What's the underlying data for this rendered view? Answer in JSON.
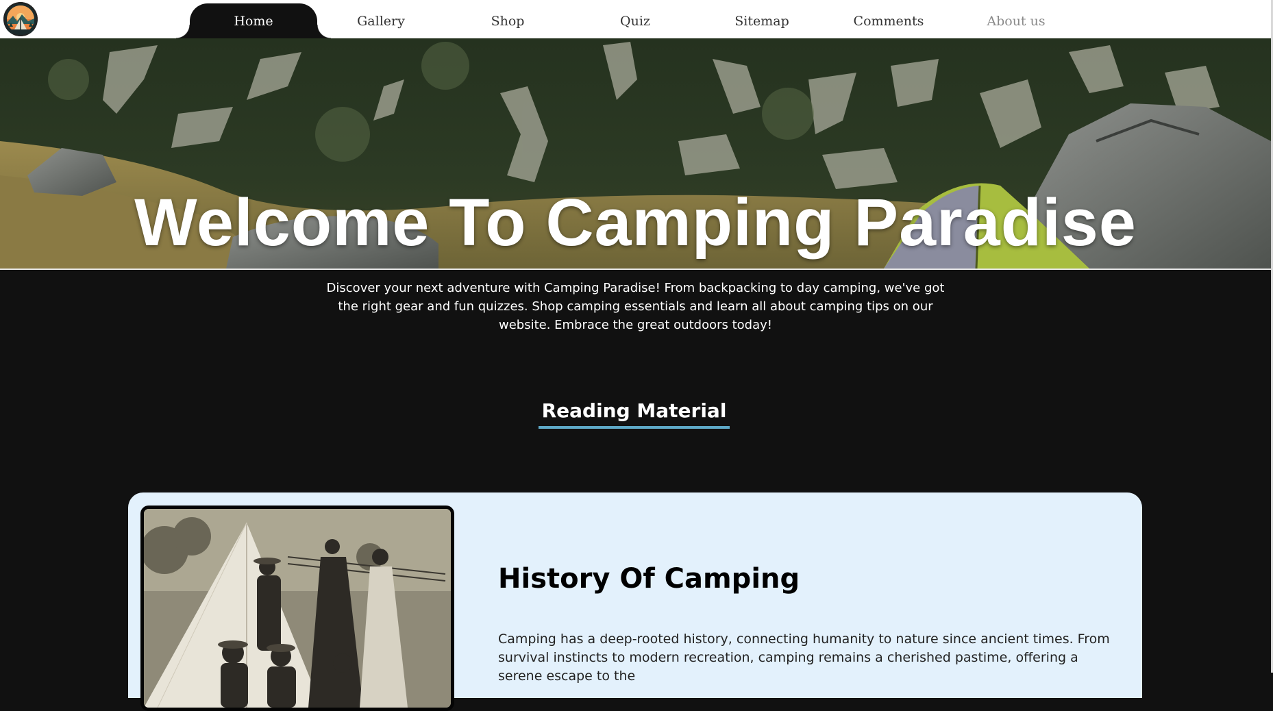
{
  "nav": {
    "items": [
      {
        "label": "Home",
        "active": true
      },
      {
        "label": "Gallery",
        "active": false
      },
      {
        "label": "Shop",
        "active": false
      },
      {
        "label": "Quiz",
        "active": false
      },
      {
        "label": "Sitemap",
        "active": false
      },
      {
        "label": "Comments",
        "active": false
      },
      {
        "label": "About us",
        "active": false
      }
    ]
  },
  "logo": {
    "icon": "camping-tent-logo"
  },
  "hero": {
    "title": "Welcome To Camping Paradise",
    "image": "mountain-meadow-with-tent"
  },
  "intro": {
    "text": "Discover your next adventure with Camping Paradise! From backpacking to day camping, we've got the right gear and fun quizzes. Shop camping essentials and learn all about camping tips on our website. Embrace the great outdoors today!"
  },
  "reading": {
    "heading": "Reading Material",
    "underline_color": "#5ea9c7"
  },
  "article": {
    "title": "History Of Camping",
    "text": "Camping has a deep-rooted history, connecting humanity to nature since ancient times. From survival instincts to modern recreation, camping remains a cherished pastime, offering a serene escape to the",
    "image": "vintage-campers-photo"
  },
  "colors": {
    "page_bg": "#111111",
    "nav_bg": "#ffffff",
    "card_bg": "#e3f1fc",
    "accent": "#5ea9c7"
  }
}
